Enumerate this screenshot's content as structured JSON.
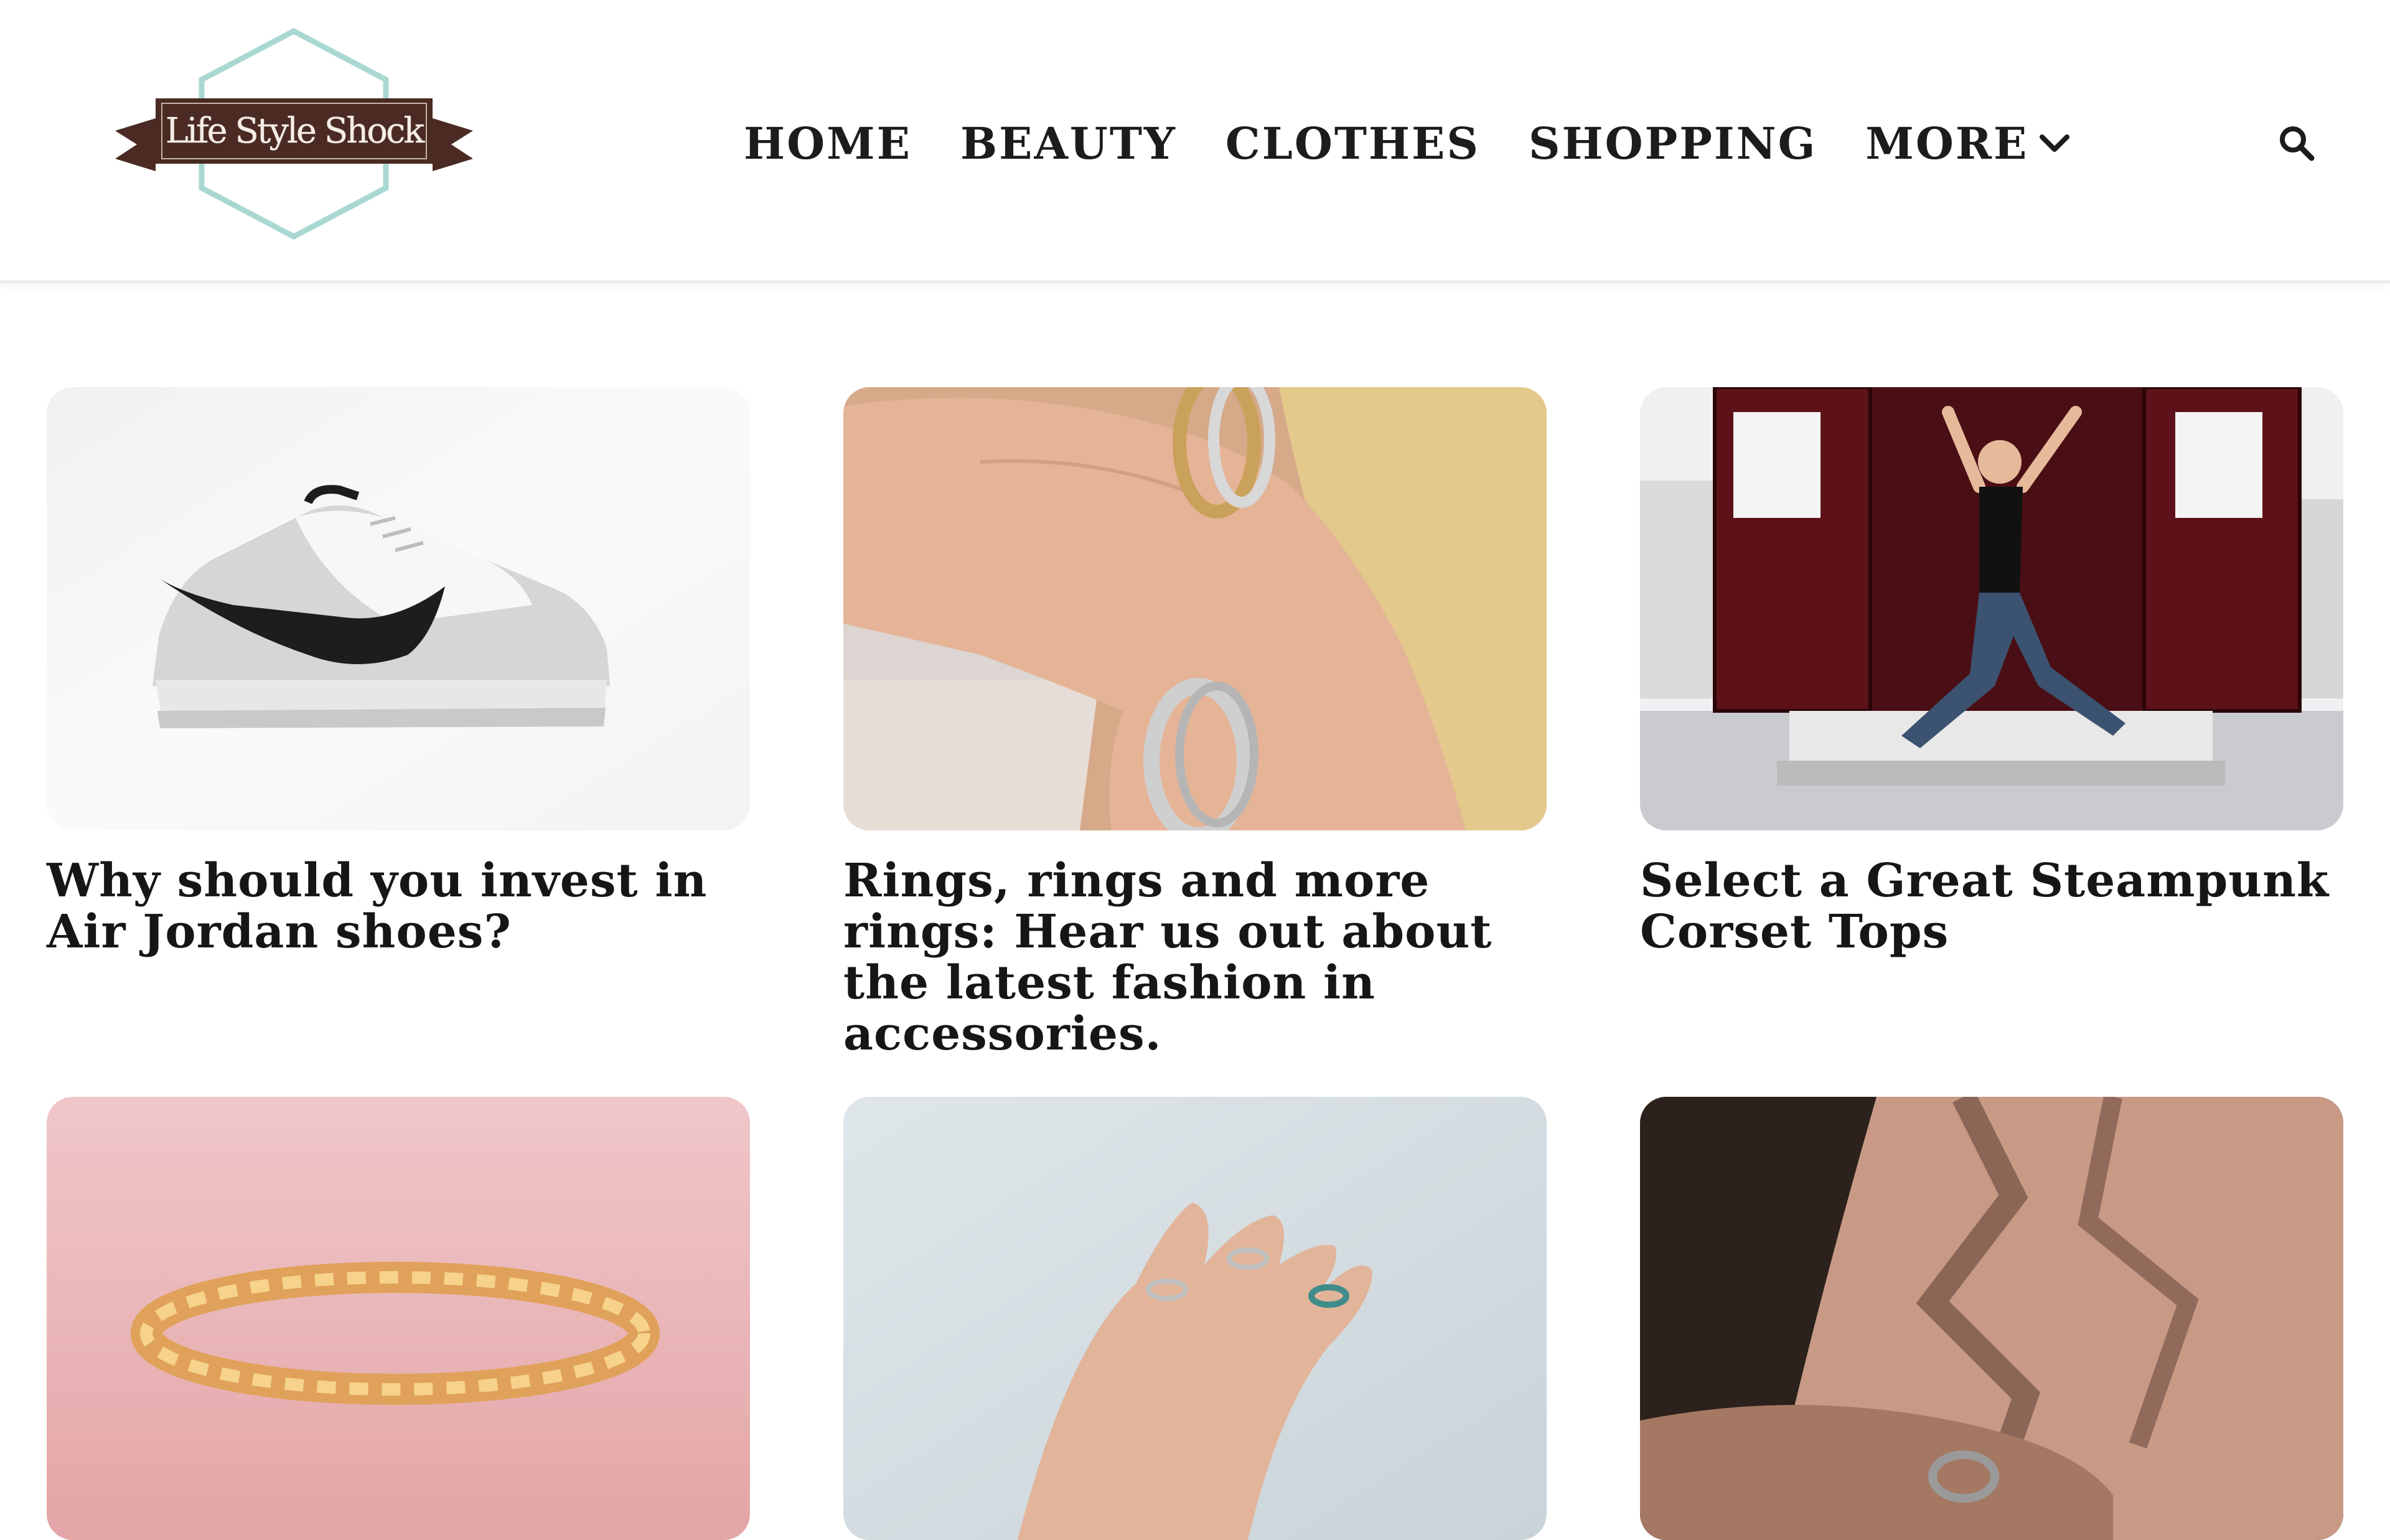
{
  "site": {
    "logo_text": "Life Style Shock"
  },
  "nav": {
    "items": [
      {
        "label": "HOME"
      },
      {
        "label": "BEAUTY"
      },
      {
        "label": "CLOTHES"
      },
      {
        "label": "SHOPPING"
      },
      {
        "label": "MORE"
      }
    ]
  },
  "articles": [
    {
      "title": "Why should you invest in Air Jordan shoes?",
      "image": "sneaker"
    },
    {
      "title": "Rings, rings and more rings: Hear us out about the latest fashion in accessories.",
      "image": "rings-hand"
    },
    {
      "title": "Select a Great Steampunk Corset Tops",
      "image": "woman-in-van"
    },
    {
      "title": "",
      "image": "gold-bracelet"
    },
    {
      "title": "",
      "image": "hand-with-rings"
    },
    {
      "title": "",
      "image": "hand-in-shadow"
    }
  ],
  "icons": {
    "search": "search-icon",
    "more": "chevron-down-icon"
  },
  "colors": {
    "logo_brown": "#4a2a22",
    "logo_teal": "#a9d8d2",
    "text": "#1b1b1b"
  }
}
